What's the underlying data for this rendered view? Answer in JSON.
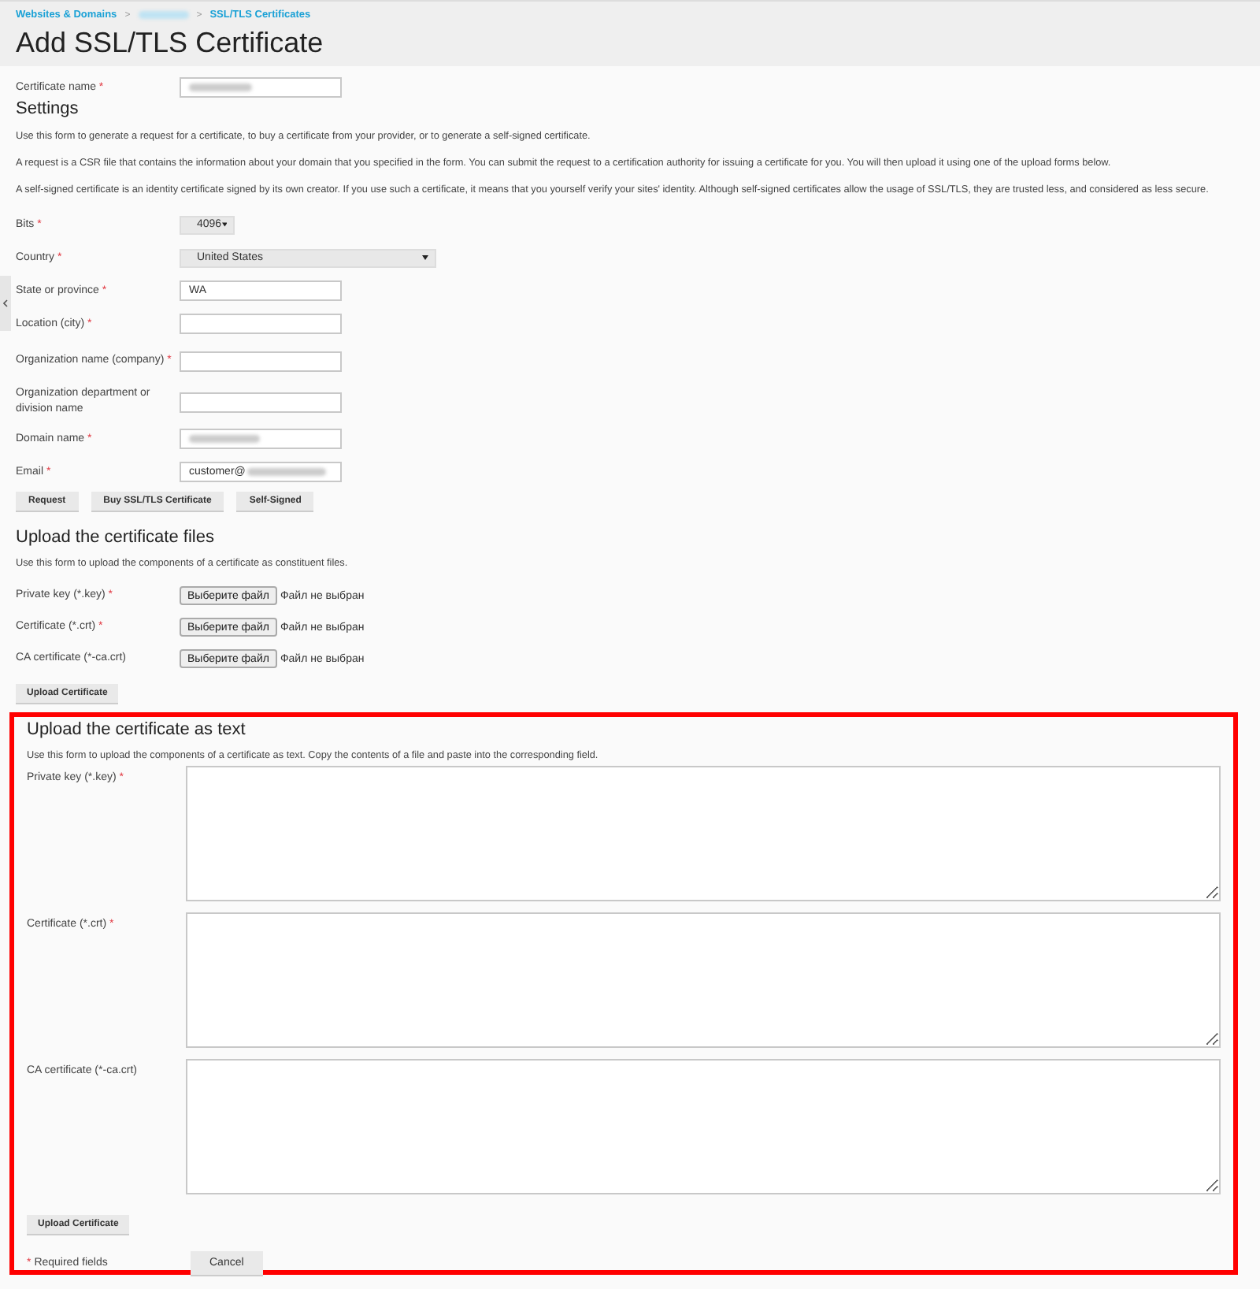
{
  "breadcrumbs": [
    {
      "label": "Websites & Domains",
      "blurred": false
    },
    {
      "blurred": true
    },
    {
      "label": "SSL/TLS Certificates",
      "blurred": false
    }
  ],
  "breadcrumb_separator": ">",
  "required_mark": "*",
  "title": "Add SSL/TLS Certificate",
  "certificate_name": {
    "label": "Certificate name",
    "required": true,
    "blurred": true
  },
  "settings": {
    "heading": "Settings",
    "paragraphs": [
      "Use this form to generate a request for a certificate, to buy a certificate from your provider, or to generate a self-signed certificate.",
      "A request is a CSR file that contains the information about your domain that you specified in the form. You can submit the request to a certification authority for issuing a certificate for you. You will then upload it using one of the upload forms below.",
      "A self-signed certificate is an identity certificate signed by its own creator. If you use such a certificate, it means that you yourself verify your sites' identity. Although self-signed certificates allow the usage of SSL/TLS, they are trusted less, and considered as less secure."
    ],
    "fields": [
      {
        "kind": "picker",
        "label": "Bits",
        "required": true,
        "value": "4096"
      },
      {
        "kind": "select",
        "label": "Country",
        "required": true,
        "value": "United States"
      },
      {
        "kind": "text",
        "label": "State or province",
        "required": true,
        "value": "WA",
        "blurred": false
      },
      {
        "kind": "text",
        "label": "Location (city)",
        "required": true,
        "blurred": false
      },
      {
        "kind": "text",
        "label": "Organization name (company)",
        "required": true,
        "blurred": false
      },
      {
        "kind": "text",
        "label": "Organization department or division name",
        "required": false,
        "blurred": false
      },
      {
        "kind": "text",
        "label": "Domain name",
        "required": true,
        "blurred": true
      },
      {
        "kind": "text",
        "label": "Email",
        "required": true,
        "value": "customer@",
        "blurred": true
      }
    ],
    "buttons": [
      "Request",
      "Buy SSL/TLS Certificate",
      "Self-Signed"
    ]
  },
  "upload_files": {
    "heading": "Upload the certificate files",
    "description": "Use this form to upload the components of a certificate as constituent files.",
    "rows": [
      {
        "label": "Private key (*.key)",
        "required": true,
        "button": "Выберите файл",
        "status": "Файл не выбран"
      },
      {
        "label": "Certificate (*.crt)",
        "required": true,
        "button": "Выберите файл",
        "status": "Файл не выбран"
      },
      {
        "label": "CA certificate (*-ca.crt)",
        "required": false,
        "button": "Выберите файл",
        "status": "Файл не выбран"
      }
    ],
    "button": "Upload Certificate"
  },
  "upload_text": {
    "heading": "Upload the certificate as text",
    "description": "Use this form to upload the components of a certificate as text. Copy the contents of a file and paste into the corresponding field.",
    "highlighted": true,
    "fields": [
      {
        "label": "Private key (*.key)",
        "required": true
      },
      {
        "label": "Certificate (*.crt)",
        "required": true
      },
      {
        "label": "CA certificate (*-ca.crt)",
        "required": false
      }
    ],
    "button": "Upload Certificate",
    "required_note": "Required fields",
    "cancel": "Cancel"
  }
}
